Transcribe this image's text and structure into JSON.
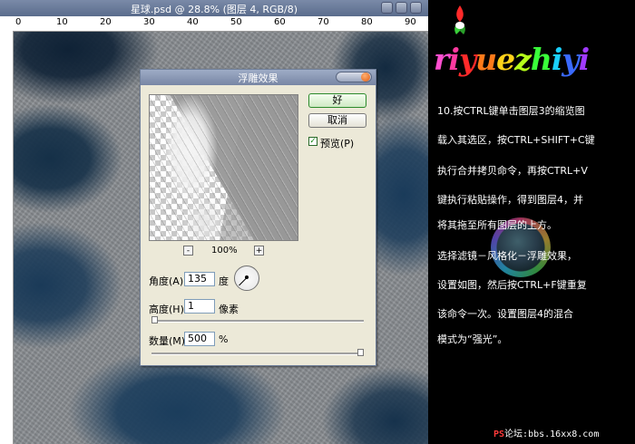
{
  "window": {
    "title": "星球.psd @ 28.8% (图层 4, RGB/8)",
    "ruler_marks": [
      "0",
      "10",
      "20",
      "30",
      "40",
      "50",
      "60",
      "70",
      "80",
      "90"
    ]
  },
  "dialog": {
    "title": "浮雕效果",
    "ok_label": "好",
    "cancel_label": "取消",
    "preview_label": "预览(P)",
    "preview_checked": true,
    "zoom_minus": "-",
    "zoom_plus": "+",
    "zoom_value": "100%",
    "angle": {
      "label": "角度(A):",
      "value": "135",
      "unit": "度"
    },
    "height": {
      "label": "高度(H):",
      "value": "1",
      "unit": "像素"
    },
    "amount": {
      "label": "数量(M):",
      "value": "500",
      "unit": "%"
    },
    "height_slider_fraction": 0.0,
    "amount_slider_fraction": 1.0
  },
  "side": {
    "logo_letters": [
      "r",
      "i",
      "y",
      "u",
      "e",
      "z",
      "h",
      "i",
      "y",
      "i"
    ],
    "logo_colors": [
      "#ff4fd0",
      "#ff3aa0",
      "#ff2a2a",
      "#ff7a1a",
      "#ffd21a",
      "#b6ff1a",
      "#3aff3a",
      "#1ad0ff",
      "#3a6aff",
      "#a03aff"
    ],
    "lines": [
      "10.按CTRL键单击图层3的缩览图",
      "载入其选区，按CTRL+SHIFT+C键",
      "执行合并拷贝命令，再按CTRL+V",
      "键执行粘贴操作，得到图层4，并",
      "将其拖至所有图层的上方。",
      "选择滤镜－风格化－浮雕效果，",
      "设置如图，然后按CTRL+F键重复",
      "该命令一次。设置图层4的混合",
      "模式为“强光”。"
    ],
    "footer_ps": "PS",
    "footer_text": "论坛:bbs.16xx8.com"
  }
}
